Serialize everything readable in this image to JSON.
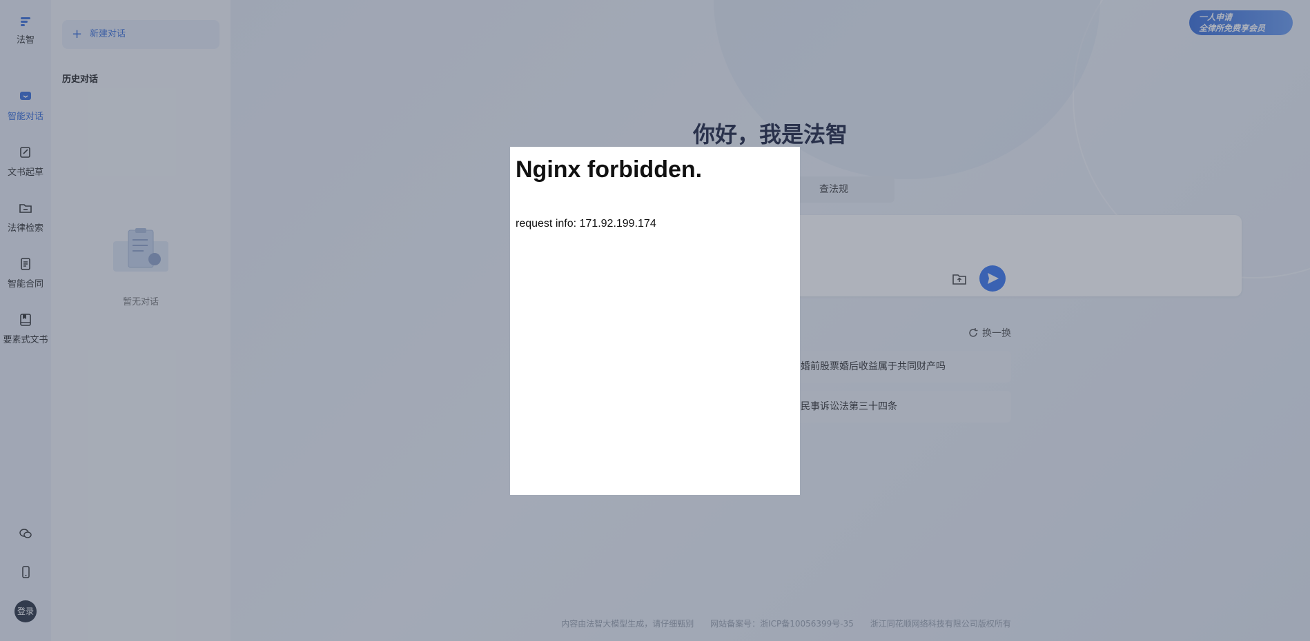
{
  "app": {
    "name": "法智"
  },
  "rail": {
    "items": [
      {
        "label": "智能对话",
        "icon": "chat-icon",
        "active": true
      },
      {
        "label": "文书起草",
        "icon": "pen-doc-icon",
        "active": false
      },
      {
        "label": "法律检索",
        "icon": "folder-search-icon",
        "active": false
      },
      {
        "label": "智能合同",
        "icon": "contract-icon",
        "active": false
      },
      {
        "label": "要素式文书",
        "icon": "book-icon",
        "active": false
      }
    ],
    "bottom": {
      "wechat_icon": "wechat-icon",
      "mobile_icon": "mobile-icon",
      "login_label": "登录"
    }
  },
  "sidebar": {
    "new_chat_label": "新建对话",
    "history_title": "历史对话",
    "empty_text": "暂无对话"
  },
  "main": {
    "greeting": "你好，我是法智",
    "tab_label": "查法规",
    "refresh_label": "换一换",
    "suggestions": [
      "婚前股票婚后收益属于共同财产吗",
      "民事诉讼法第三十四条"
    ],
    "promo": {
      "line1": "一人申请",
      "line2": "全律所免费享会员"
    }
  },
  "footer": {
    "disclaimer": "内容由法智大模型生成，请仔细甄别",
    "icp": "网站备案号：浙ICP备10056399号-35",
    "copyright": "浙江同花顺网络科技有限公司版权所有"
  },
  "modal": {
    "title": "Nginx forbidden.",
    "info": "request info: 171.92.199.174"
  },
  "colors": {
    "accent": "#3a6fd9",
    "send": "#3a78f2",
    "overlay": "rgba(60,70,90,0.42)"
  }
}
